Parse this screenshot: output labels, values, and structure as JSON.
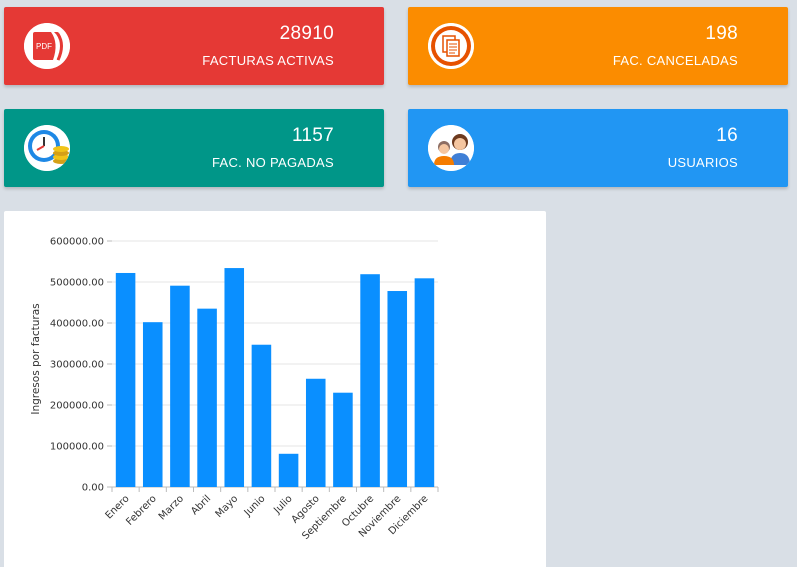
{
  "cards": [
    {
      "value": "28910",
      "label": "FACTURAS ACTIVAS",
      "color": "#e53935",
      "icon": "pdf-icon"
    },
    {
      "value": "198",
      "label": "FAC. CANCELADAS",
      "color": "#fb8c00",
      "icon": "document-copy-icon"
    },
    {
      "value": "1157",
      "label": "FAC. NO PAGADAS",
      "color": "#009688",
      "icon": "clock-coins-icon"
    },
    {
      "value": "16",
      "label": "USUARIOS",
      "color": "#2196f3",
      "icon": "users-icon"
    }
  ],
  "chart_data": {
    "type": "bar",
    "categories": [
      "Enero",
      "Febrero",
      "Marzo",
      "Abril",
      "Mayo",
      "Junio",
      "Julio",
      "Agosto",
      "Septiembre",
      "Octubre",
      "Noviembre",
      "Diciembre"
    ],
    "values": [
      522000,
      402000,
      491000,
      435000,
      534000,
      347000,
      81000,
      264000,
      230000,
      519000,
      478000,
      509000
    ],
    "ylabel": "Ingresos por facturas",
    "xlabel": "",
    "ylim": [
      0,
      600000
    ],
    "yticks": [
      "0.00",
      "100000.00",
      "200000.00",
      "300000.00",
      "400000.00",
      "500000.00",
      "600000.00"
    ],
    "bar_color": "#0a8fff",
    "grid": true
  },
  "pdf_icon_text": "PDF"
}
